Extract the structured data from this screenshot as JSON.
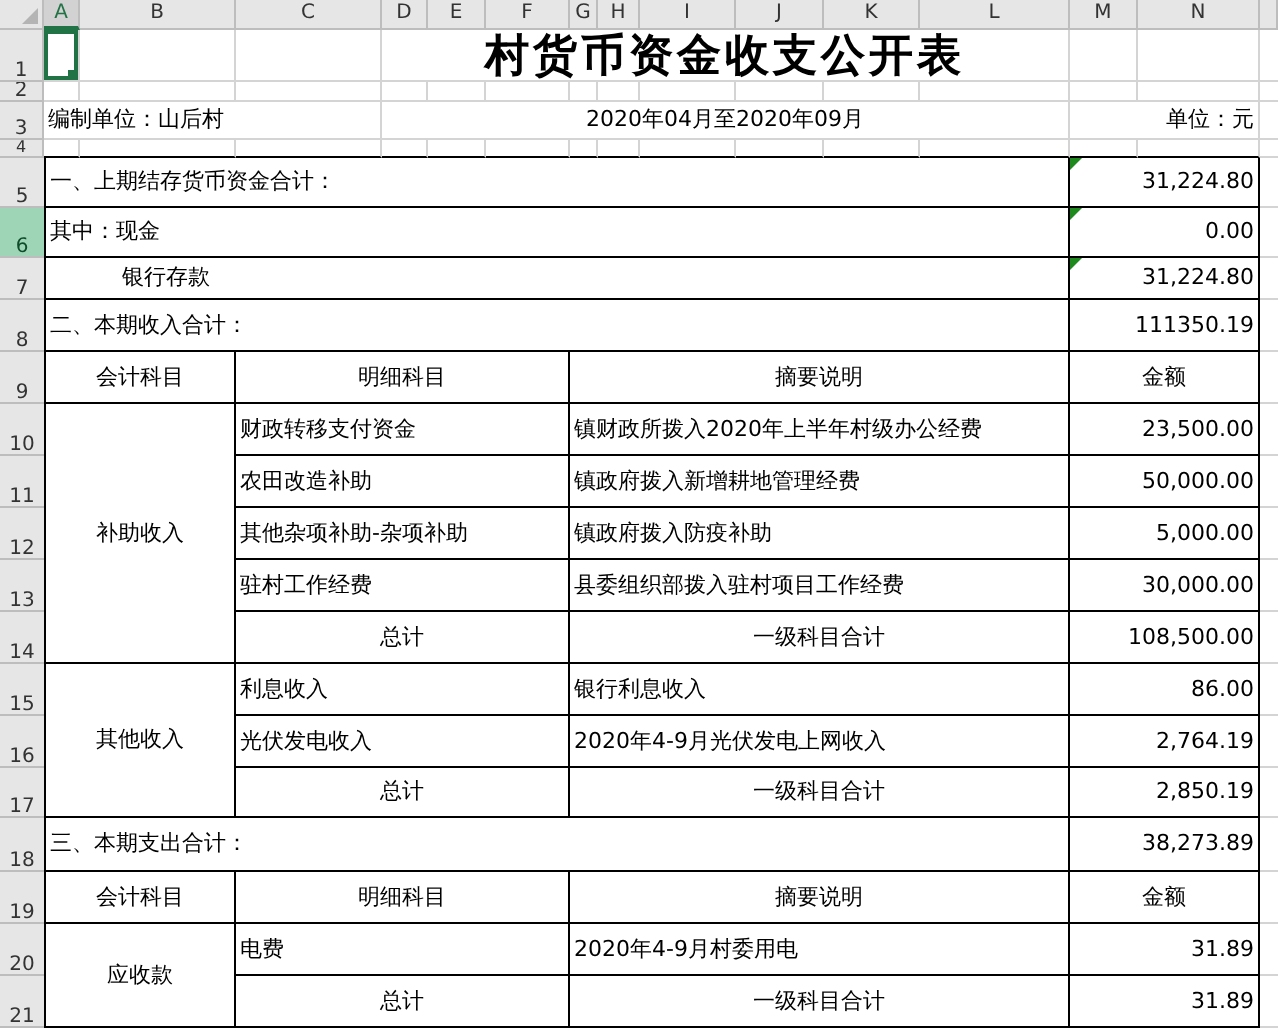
{
  "sheet": {
    "columns": [
      {
        "label": "A",
        "selected": true
      },
      {
        "label": "B",
        "selected": false
      },
      {
        "label": "C",
        "selected": false
      },
      {
        "label": "D",
        "selected": false
      },
      {
        "label": "E",
        "selected": false
      },
      {
        "label": "F",
        "selected": false
      },
      {
        "label": "G",
        "selected": false
      },
      {
        "label": "H",
        "selected": false
      },
      {
        "label": "I",
        "selected": false
      },
      {
        "label": "J",
        "selected": false
      },
      {
        "label": "K",
        "selected": false
      },
      {
        "label": "L",
        "selected": false
      },
      {
        "label": "M",
        "selected": false
      },
      {
        "label": "N",
        "selected": false
      }
    ],
    "rows": [
      {
        "label": "1",
        "selected": false
      },
      {
        "label": "2",
        "selected": false
      },
      {
        "label": "3",
        "selected": false
      },
      {
        "label": "4",
        "selected": false
      },
      {
        "label": "5",
        "selected": false
      },
      {
        "label": "6",
        "selected": true
      },
      {
        "label": "7",
        "selected": false
      },
      {
        "label": "8",
        "selected": false
      },
      {
        "label": "9",
        "selected": false
      },
      {
        "label": "10",
        "selected": false
      },
      {
        "label": "11",
        "selected": false
      },
      {
        "label": "12",
        "selected": false
      },
      {
        "label": "13",
        "selected": false
      },
      {
        "label": "14",
        "selected": false
      },
      {
        "label": "15",
        "selected": false
      },
      {
        "label": "16",
        "selected": false
      },
      {
        "label": "17",
        "selected": false
      },
      {
        "label": "18",
        "selected": false
      },
      {
        "label": "19",
        "selected": false
      },
      {
        "label": "20",
        "selected": false
      },
      {
        "label": "21",
        "selected": false
      }
    ],
    "title": "村货币资金收支公开表",
    "info": {
      "unit": "编制单位：山后村",
      "period": "2020年04月至2020年09月",
      "currency": "单位：元"
    },
    "blocks": [
      {
        "kind": "line",
        "label": "一、上期结存货币资金合计：",
        "amount": "31,224.80",
        "flag": true,
        "indent": false
      },
      {
        "kind": "line",
        "label": "其中：现金",
        "amount": "0.00",
        "flag": true,
        "indent": false
      },
      {
        "kind": "line",
        "label": "银行存款",
        "amount": "31,224.80",
        "flag": true,
        "indent": true
      },
      {
        "kind": "line",
        "label": "二、本期收入合计：",
        "amount": "111350.19",
        "flag": false,
        "indent": false
      },
      {
        "kind": "header",
        "cells": [
          "会计科目",
          "明细科目",
          "摘要说明",
          "金额"
        ]
      },
      {
        "kind": "group",
        "account": "补助收入",
        "items": [
          {
            "detail": "财政转移支付资金",
            "summary": "镇财政所拨入2020年上半年村级办公经费",
            "amount": "23,500.00"
          },
          {
            "detail": "农田改造补助",
            "summary": "镇政府拨入新增耕地管理经费",
            "amount": "50,000.00"
          },
          {
            "detail": "其他杂项补助-杂项补助",
            "summary": "镇政府拨入防疫补助",
            "amount": "5,000.00"
          },
          {
            "detail": "驻村工作经费",
            "summary": "县委组织部拨入驻村项目工作经费",
            "amount": "30,000.00"
          }
        ],
        "total": {
          "detail": "总计",
          "summary": "一级科目合计",
          "amount": "108,500.00"
        }
      },
      {
        "kind": "group",
        "account": "其他收入",
        "items": [
          {
            "detail": "利息收入",
            "summary": "银行利息收入",
            "amount": "86.00"
          },
          {
            "detail": "光伏发电收入",
            "summary": "2020年4-9月光伏发电上网收入",
            "amount": "2,764.19"
          }
        ],
        "total": {
          "detail": "总计",
          "summary": "一级科目合计",
          "amount": "2,850.19"
        }
      },
      {
        "kind": "line",
        "label": "三、本期支出合计：",
        "amount": "38,273.89",
        "flag": false,
        "indent": false
      },
      {
        "kind": "header",
        "cells": [
          "会计科目",
          "明细科目",
          "摘要说明",
          "金额"
        ]
      },
      {
        "kind": "group",
        "account": "应收款",
        "items": [
          {
            "detail": "电费",
            "summary": "2020年4-9月村委用电",
            "amount": "31.89"
          }
        ],
        "total": {
          "detail": "总计",
          "summary": "一级科目合计",
          "amount": "31.89"
        }
      }
    ]
  }
}
